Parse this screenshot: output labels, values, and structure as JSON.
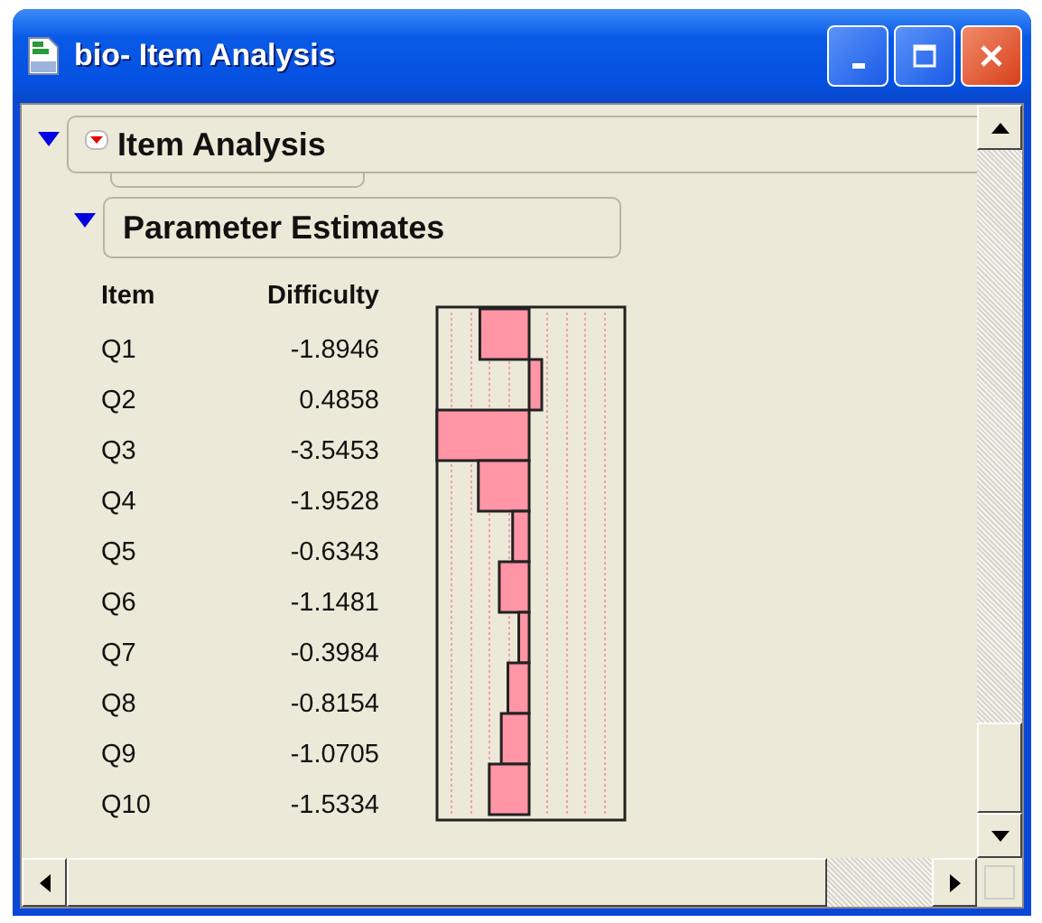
{
  "window": {
    "title": "bio- Item Analysis"
  },
  "report": {
    "title": "Item Analysis",
    "expanded": true,
    "menu": true,
    "section": {
      "title": "Parameter Estimates",
      "expanded": true,
      "table": {
        "columns": [
          "Item",
          "Difficulty"
        ],
        "rows": [
          {
            "item": "Q1",
            "difficulty": "-1.8946"
          },
          {
            "item": "Q2",
            "difficulty": "0.4858"
          },
          {
            "item": "Q3",
            "difficulty": "-3.5453"
          },
          {
            "item": "Q4",
            "difficulty": "-1.9528"
          },
          {
            "item": "Q5",
            "difficulty": "-0.6343"
          },
          {
            "item": "Q6",
            "difficulty": "-1.1481"
          },
          {
            "item": "Q7",
            "difficulty": "-0.3984"
          },
          {
            "item": "Q8",
            "difficulty": "-0.8154"
          },
          {
            "item": "Q9",
            "difficulty": "-1.0705"
          },
          {
            "item": "Q10",
            "difficulty": "-1.5334"
          }
        ]
      }
    }
  }
}
